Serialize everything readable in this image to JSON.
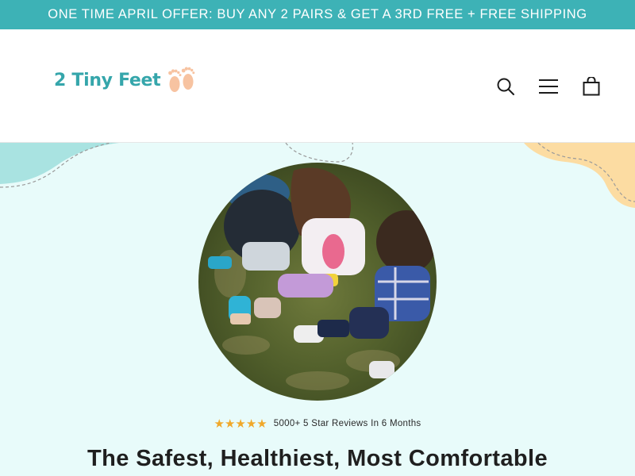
{
  "announcement": {
    "text": "ONE TIME APRIL OFFER: BUY ANY 2 PAIRS & GET A 3RD FREE + FREE SHIPPING",
    "background": "#3db2b6"
  },
  "header": {
    "logo": {
      "text": "2 Tiny Feet",
      "color": "#35a6ab",
      "accent_color": "#f7c3a1"
    },
    "icons": [
      {
        "name": "search-icon",
        "label": "Search"
      },
      {
        "name": "menu-icon",
        "label": "Menu"
      },
      {
        "name": "cart-icon",
        "label": "Cart"
      }
    ]
  },
  "hero": {
    "background": "#e8fbfa",
    "rating": {
      "stars": "★★★★★",
      "star_color": "#f0a82a",
      "text": "5000+ 5 Star Reviews In 6 Months"
    },
    "headline": "The Safest, Healthiest, Most Comfortable"
  }
}
